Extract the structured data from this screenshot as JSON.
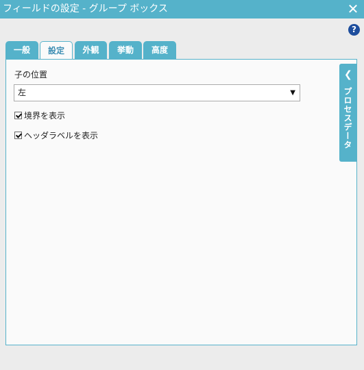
{
  "window": {
    "title": "フィールドの設定 - グループ ボックス",
    "close_icon": "✕"
  },
  "help": {
    "label": "?"
  },
  "tabs": [
    {
      "label": "一般",
      "active": false
    },
    {
      "label": "設定",
      "active": true
    },
    {
      "label": "外観",
      "active": false
    },
    {
      "label": "挙動",
      "active": false
    },
    {
      "label": "高度",
      "active": false
    }
  ],
  "settings": {
    "child_position_label": "子の位置",
    "child_position_value": "左",
    "show_border_label": "境界を表示",
    "show_border_checked": true,
    "show_header_label": "ヘッダラベルを表示",
    "show_header_checked": true
  },
  "side_panel": {
    "label": "プロセスデータ"
  },
  "colors": {
    "accent": "#55b2ca",
    "help": "#1e4e9d"
  }
}
